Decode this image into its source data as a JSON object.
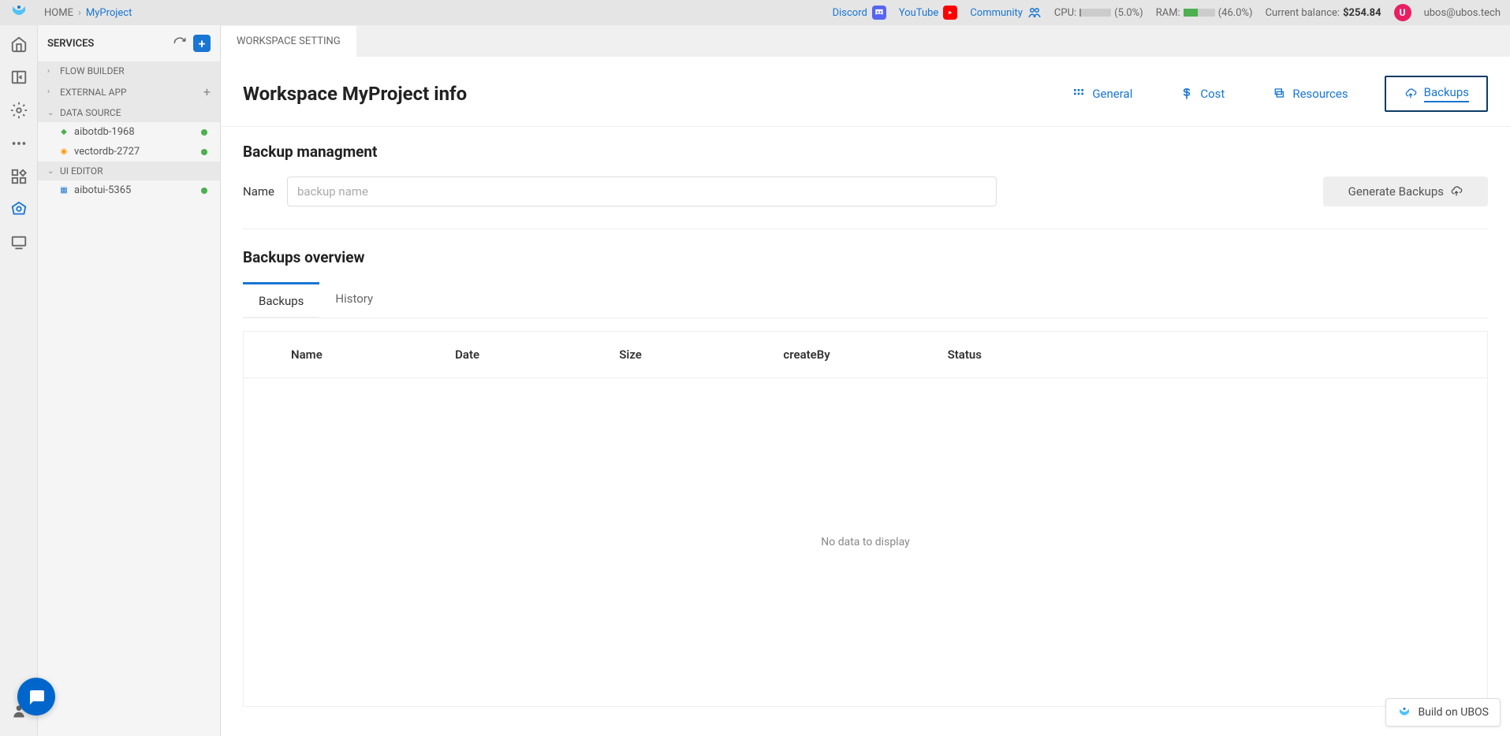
{
  "topbar": {
    "breadcrumb_home": "HOME",
    "breadcrumb_project": "MyProject",
    "discord": "Discord",
    "youtube": "YouTube",
    "community": "Community",
    "cpu_label": "CPU:",
    "cpu_pct_text": "(5.0%)",
    "cpu_pct": 5.0,
    "ram_label": "RAM:",
    "ram_pct_text": "(46.0%)",
    "ram_pct": 46.0,
    "balance_label": "Current balance:",
    "balance_amount": "$254.84",
    "avatar_letter": "U",
    "user_email": "ubos@ubos.tech"
  },
  "sidebar": {
    "title": "SERVICES",
    "groups": {
      "flow": "FLOW BUILDER",
      "external": "EXTERNAL APP",
      "datasource": "DATA SOURCE",
      "uieditor": "UI EDITOR"
    },
    "items": {
      "aibotdb": "aibotdb-1968",
      "vectordb": "vectordb-2727",
      "aibotui": "aibotui-5365"
    }
  },
  "content": {
    "tab_title": "WORKSPACE SETTING",
    "page_title": "Workspace MyProject info",
    "nav": {
      "general": "General",
      "cost": "Cost",
      "resources": "Resources",
      "backups": "Backups"
    },
    "backup_section_title": "Backup managment",
    "name_label": "Name",
    "name_placeholder": "backup name",
    "generate_btn": "Generate Backups",
    "overview_title": "Backups overview",
    "overview_tabs": {
      "backups": "Backups",
      "history": "History"
    },
    "table_headers": {
      "name": "Name",
      "date": "Date",
      "size": "Size",
      "createBy": "createBy",
      "status": "Status"
    },
    "empty_msg": "No data to display"
  },
  "footer": {
    "build_badge": "Build on UBOS"
  }
}
